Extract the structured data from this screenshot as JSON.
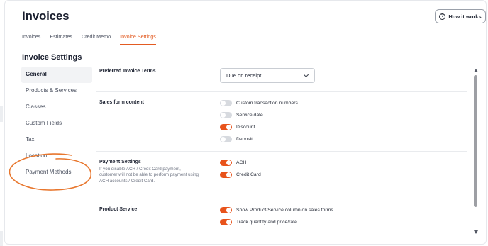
{
  "page": {
    "title": "Invoices",
    "how_it_works": "How it works",
    "how_it_works_icon": "question-circle-icon"
  },
  "tabs": [
    {
      "label": "Invoices",
      "active": false
    },
    {
      "label": "Estimates",
      "active": false
    },
    {
      "label": "Credit Memo",
      "active": false
    },
    {
      "label": "Invoice Settings",
      "active": true
    }
  ],
  "settings": {
    "section_title": "Invoice Settings",
    "nav": [
      {
        "label": "General",
        "active": true
      },
      {
        "label": "Products & Services",
        "active": false
      },
      {
        "label": "Classes",
        "active": false
      },
      {
        "label": "Custom Fields",
        "active": false
      },
      {
        "label": "Tax",
        "active": false
      },
      {
        "label": "Location",
        "active": false
      },
      {
        "label": "Payment Methods",
        "active": false
      }
    ],
    "rows": [
      {
        "title": "Preferred Invoice Terms",
        "select_value": "Due on receipt"
      },
      {
        "title": "Sales form content",
        "toggles": [
          {
            "label": "Custom transaction numbers",
            "on": false
          },
          {
            "label": "Service date",
            "on": false
          },
          {
            "label": "Discount",
            "on": true
          },
          {
            "label": "Deposit",
            "on": false
          }
        ]
      },
      {
        "title": "Payment Settings",
        "description": "If you disable ACH / Credit Card payment, customer will not be able to perform payment using ACH accounts / Credit Card.",
        "toggles": [
          {
            "label": "ACH",
            "on": true
          },
          {
            "label": "Credit Card",
            "on": true
          }
        ]
      },
      {
        "title": "Product Service",
        "toggles": [
          {
            "label": "Show Product/Service column on sales forms",
            "on": true
          },
          {
            "label": "Track quantity and price/rate",
            "on": true
          }
        ]
      }
    ]
  },
  "colors": {
    "accent": "#e8531b",
    "active_tab": "#e35b22",
    "annotation_circle": "#e8772e"
  }
}
